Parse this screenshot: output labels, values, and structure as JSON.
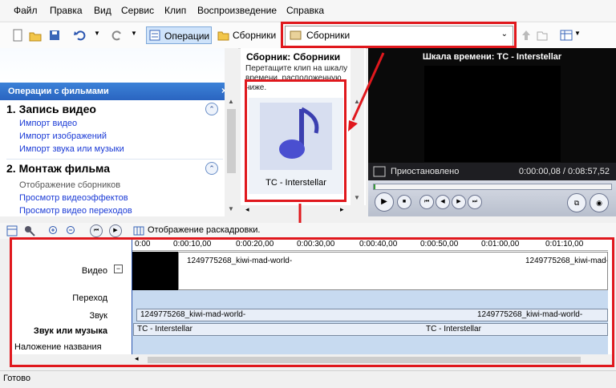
{
  "menu": {
    "file": "Файл",
    "edit": "Правка",
    "view": "Вид",
    "service": "Сервис",
    "clip": "Клип",
    "playback": "Воспроизведение",
    "help": "Справка"
  },
  "toolbar": {
    "operations": "Операции",
    "collections": "Сборники",
    "collection_select": "Сборники"
  },
  "tasks": {
    "header": "Операции с фильмами",
    "sections": [
      {
        "title": "1. Запись видео",
        "links": [
          "Импорт видео",
          "Импорт изображений",
          "Импорт звука или музыки"
        ]
      },
      {
        "title": "2. Монтаж фильма",
        "links": [
          "Отображение сборников",
          "Просмотр видеоэффектов",
          "Просмотр видео переходов"
        ]
      }
    ]
  },
  "collection": {
    "title": "Сборник: Сборники",
    "hint": "Перетащите клип на шкалу времени, расположенную ниже.",
    "item_label": "TC - Interstellar"
  },
  "monitor": {
    "title": "Шкала времени: TC - Interstellar",
    "status": "Приостановлено",
    "time": "0:00:00,08 / 0:08:57,52",
    "progress": 0.0002
  },
  "timeline": {
    "storyboard_label": "Отображение раскадровки.",
    "ruler": [
      "0:00",
      "0:00:10,00",
      "0:00:20,00",
      "0:00:30,00",
      "0:00:40,00",
      "0:00:50,00",
      "0:01:00,00",
      "0:01:10,00"
    ],
    "tracks": {
      "video": "Видео",
      "transition": "Переход",
      "audio": "Звук",
      "music": "Звук или музыка",
      "title_overlay": "Наложение названия"
    },
    "video_clip": "1249775268_kiwi-mad-world-",
    "audio_clip": "1249775268_kiwi-mad-world-",
    "music_clip": "TC - Interstellar"
  },
  "status": {
    "text": "Готово"
  },
  "colors": {
    "accent": "#e0181d",
    "link": "#1a3ad6",
    "header_blue": "#2a64c0"
  }
}
